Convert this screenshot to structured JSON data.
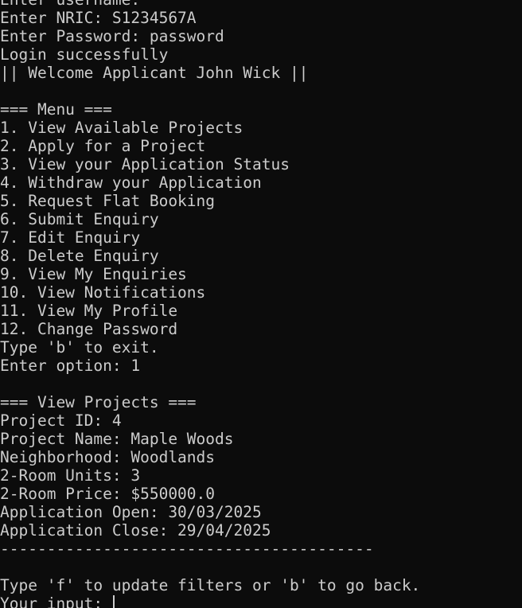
{
  "terminal": {
    "lines": [
      "Enter username:",
      "Enter NRIC: S1234567A",
      "Enter Password: password",
      "Login successfully",
      "|| Welcome Applicant John Wick ||",
      "",
      "=== Menu ===",
      "1. View Available Projects",
      "2. Apply for a Project",
      "3. View your Application Status",
      "4. Withdraw your Application",
      "5. Request Flat Booking",
      "6. Submit Enquiry",
      "7. Edit Enquiry",
      "8. Delete Enquiry",
      "9. View My Enquiries",
      "10. View Notifications",
      "11. View My Profile",
      "12. Change Password",
      "Type 'b' to exit.",
      "Enter option: 1",
      "",
      "=== View Projects ===",
      "Project ID: 4",
      "Project Name: Maple Woods",
      "Neighborhood: Woodlands",
      "2-Room Units: 3",
      "2-Room Price: $550000.0",
      "Application Open: 30/03/2025",
      "Application Close: 29/04/2025",
      "----------------------------------------",
      "",
      "Type 'f' to update filters or 'b' to go back."
    ],
    "prompt": "Your input: "
  },
  "colors": {
    "background": "#0c0c0c",
    "foreground": "#cccccc"
  }
}
